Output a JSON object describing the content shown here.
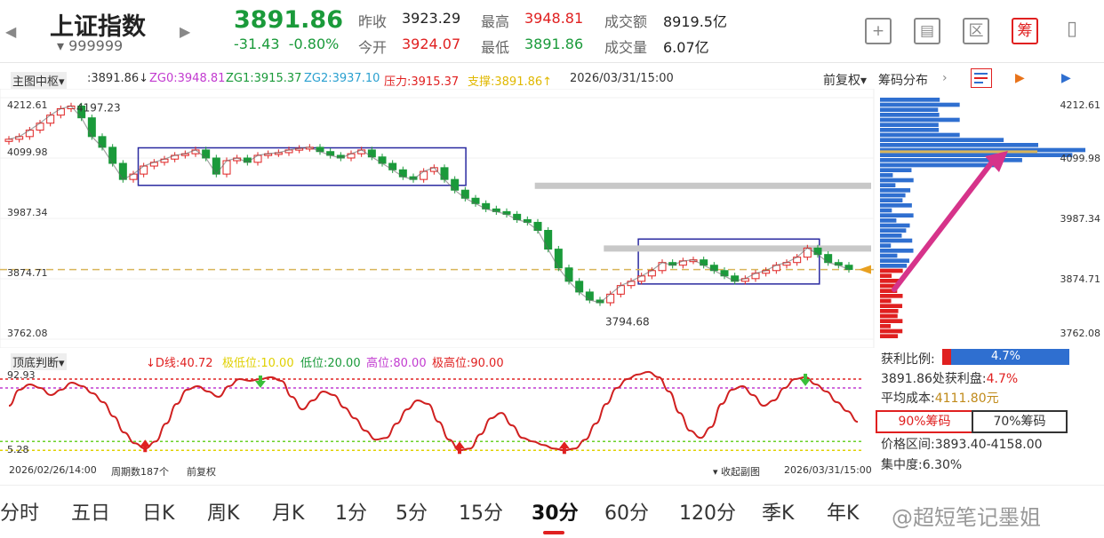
{
  "header": {
    "name": "上证指数",
    "code": "▾ 999999",
    "price": "3891.86",
    "change": "-31.43",
    "change_pct": "-0.80%",
    "stats": {
      "prev_close_label": "昨收",
      "prev_close": "3923.29",
      "open_label": "今开",
      "open": "3924.07",
      "high_label": "最高",
      "high": "3948.81",
      "low_label": "最低",
      "low": "3891.86",
      "amount_label": "成交额",
      "amount": "8919.5亿",
      "volume_label": "成交量",
      "volume": "6.07亿"
    },
    "buttons": [
      "+",
      "▤",
      "区",
      "筹",
      "▯"
    ]
  },
  "main_toolbar": {
    "indicator": "主图中枢▾",
    "price": ":3891.86↓",
    "zg0": "ZG0:3948.81",
    "zg1": "ZG1:3915.37",
    "zg2": "ZG2:3937.10",
    "pressure": "压力:3915.37",
    "support": "支撑:3891.86↑",
    "datetime": "2026/03/31/15:00",
    "fuquan": "前复权▾",
    "chip_tab": "筹码分布"
  },
  "colors": {
    "up": "#e02020",
    "down": "#1a9a3a",
    "box": "#2a2aa0",
    "zg_line": "#c8c8c8",
    "chip_blue": "#2f6fd0",
    "chip_red": "#e02020",
    "arrow": "#d6338a",
    "avg_line": "#d9b55a"
  },
  "chart_data": [
    {
      "type": "candlestick",
      "title": "上证指数 30分",
      "y_ticks": [
        "4212.61",
        "4099.98",
        "3987.34",
        "3874.71",
        "3762.08"
      ],
      "ylim": [
        3762.08,
        4212.61
      ],
      "annotations": [
        {
          "label": "4197.23",
          "value": 4197.23
        },
        {
          "label": "3794.68",
          "value": 3794.68
        }
      ],
      "close_path": [
        4135,
        4140,
        4152,
        4165,
        4180,
        4192,
        4197,
        4175,
        4140,
        4120,
        4090,
        4060,
        4070,
        4085,
        4092,
        4098,
        4105,
        4108,
        4115,
        4100,
        4070,
        4095,
        4100,
        4092,
        4105,
        4108,
        4110,
        4115,
        4118,
        4120,
        4112,
        4105,
        4100,
        4108,
        4115,
        4102,
        4090,
        4078,
        4065,
        4060,
        4075,
        4082,
        4060,
        4040,
        4025,
        4015,
        4005,
        4000,
        3995,
        3985,
        3980,
        3965,
        3930,
        3895,
        3870,
        3850,
        3835,
        3830,
        3846,
        3862,
        3870,
        3880,
        3890,
        3905,
        3900,
        3908,
        3910,
        3900,
        3890,
        3880,
        3870,
        3875,
        3885,
        3890,
        3900,
        3905,
        3915,
        3932,
        3920,
        3905,
        3900,
        3892
      ],
      "zhongshu_boxes": [
        {
          "zg": 4119,
          "zd": 4049
        },
        {
          "zg": 3948.81,
          "zd": 3865
        }
      ],
      "zg_levels": [
        4049,
        3932
      ]
    },
    {
      "type": "line",
      "name": "顶底判断",
      "toolbar": {
        "indicator": "顶底判断▾",
        "d_line": "↓D线:40.72",
        "extreme_low": "极低位:10.00",
        "low": "低位:20.00",
        "high": "高位:80.00",
        "extreme_high": "极高位:90.00"
      },
      "y_ticks": [
        "92.93",
        "5.28"
      ],
      "ylim": [
        5.28,
        92.93
      ],
      "levels": [
        10,
        20,
        80,
        90
      ],
      "values": [
        60,
        78,
        84,
        80,
        72,
        78,
        86,
        82,
        74,
        64,
        48,
        30,
        18,
        12,
        20,
        40,
        62,
        78,
        82,
        76,
        70,
        82,
        90,
        88,
        90,
        92,
        88,
        70,
        56,
        66,
        76,
        72,
        58,
        46,
        32,
        22,
        24,
        40,
        56,
        66,
        62,
        42,
        22,
        10,
        12,
        28,
        46,
        52,
        38,
        24,
        20,
        16,
        12,
        10,
        12,
        22,
        40,
        62,
        80,
        90,
        95,
        98,
        92,
        76,
        52,
        32,
        24,
        36,
        62,
        78,
        82,
        72,
        60,
        66,
        80,
        90,
        92,
        84,
        76,
        64,
        54,
        42
      ],
      "signals": [
        {
          "type": "buy",
          "index": 13
        },
        {
          "type": "sell",
          "index": 24
        },
        {
          "type": "buy",
          "index": 43
        },
        {
          "type": "buy",
          "index": 53
        },
        {
          "type": "sell",
          "index": 76
        }
      ],
      "footer": {
        "start": "2026/02/26/14:00",
        "period": "周期数187个",
        "fq": "前复权",
        "collapse": "▾ 收起副图",
        "end": "2026/03/31/15:00"
      }
    },
    {
      "type": "bar",
      "name": "筹码分布",
      "orientation": "horizontal",
      "profile_window": [
        3762.08,
        4212.61
      ],
      "avg_cost": 4111.8
    }
  ],
  "chips": {
    "profit_label": "获利比例:",
    "profit_value": "4.7%",
    "profit_fraction": 0.047,
    "profit_line_label": "3891.86处获利盘:",
    "profit_line_value": "4.7%",
    "avg_label": "平均成本:",
    "avg_value": "4111.80元",
    "tab90": "90%筹码",
    "tab70": "70%筹码",
    "range_label": "价格区间:",
    "range_value": "3893.40-4158.00",
    "conc_label": "集中度:",
    "conc_value": "6.30%"
  },
  "tabs": [
    "分时",
    "五日",
    "日K",
    "周K",
    "月K",
    "1分",
    "5分",
    "15分",
    "30分",
    "60分",
    "120分",
    "季K",
    "年K"
  ],
  "active_tab": "30分",
  "watermark": "@超短笔记墨姐"
}
